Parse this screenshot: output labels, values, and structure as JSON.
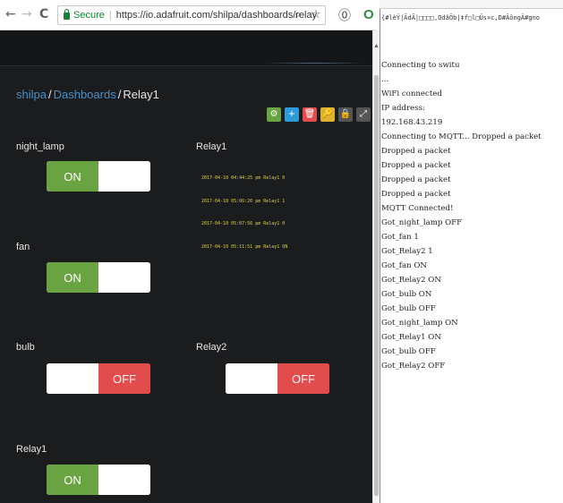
{
  "browser": {
    "back_glyph": "←",
    "forward_glyph": "→",
    "reload_glyph": "C",
    "secure_label": "Secure",
    "url": "https://io.adafruit.com/shilpa/dashboards/relay",
    "zoom_glyph": "⌕",
    "star_glyph": "☆",
    "extension_glyph": "⓪"
  },
  "dashboard": {
    "breadcrumb": {
      "user": "shilpa",
      "sep1": "/",
      "section": "Dashboards",
      "sep2": "/",
      "current": "Relay1"
    },
    "toolbar": [
      {
        "name": "settings",
        "glyph": "⚙",
        "color": "#6aa341"
      },
      {
        "name": "add",
        "glyph": "+",
        "color": "#2e9bd6"
      },
      {
        "name": "delete",
        "glyph": "🗑",
        "color": "#e14c4c"
      },
      {
        "name": "key",
        "glyph": "🔑",
        "color": "#e0b12c"
      },
      {
        "name": "lock",
        "glyph": "🔒",
        "color": "#555555"
      },
      {
        "name": "fullscreen",
        "glyph": "⤢",
        "color": "#555555"
      }
    ],
    "blocks": {
      "night_lamp": {
        "title": "night_lamp",
        "on_label": "ON",
        "off_label": "",
        "state": "on"
      },
      "fan": {
        "title": "fan",
        "on_label": "ON",
        "off_label": "",
        "state": "on"
      },
      "bulb": {
        "title": "bulb",
        "on_label": "",
        "off_label": "OFF",
        "state": "off"
      },
      "relay1_toggle": {
        "title": "Relay1",
        "on_label": "ON",
        "off_label": "",
        "state": "on"
      },
      "relay2": {
        "title": "Relay2",
        "on_label": "",
        "off_label": "OFF",
        "state": "off"
      },
      "relay1_feed": {
        "title": "Relay1",
        "entries": [
          "2017-04-10 04:44:25 pm Relay1 0",
          "2017-04-10 05:06:20 pm Relay1 1",
          "2017-04-10 05:07:56 pm Relay1 0",
          "2017-04-10 05:11:51 pm Relay1 ON"
        ]
      }
    }
  },
  "serial": {
    "garbage": "{#lèŸ|ÃdÃ|□□□□,OdâÕb|‡f□l□Ûs¤c,D#ÃôngÂ#gno",
    "lines": [
      "Connecting to switu",
      "...",
      "WiFi connected",
      "IP address:",
      "192.168.43.219",
      "Connecting to MQTT... Dropped a packet",
      "Dropped a packet",
      "Dropped a packet",
      "Dropped a packet",
      "Dropped a packet",
      "MQTT Connected!",
      "Got_night_lamp OFF",
      "Got_fan 1",
      "Got_Relay2 1",
      "Got_fan ON",
      "Got_Relay2 ON",
      "Got_bulb ON",
      "Got_bulb OFF",
      "Got_night_lamp ON",
      "Got_Relay1 ON",
      "Got_bulb OFF",
      "Got_Relay2 OFF"
    ]
  }
}
